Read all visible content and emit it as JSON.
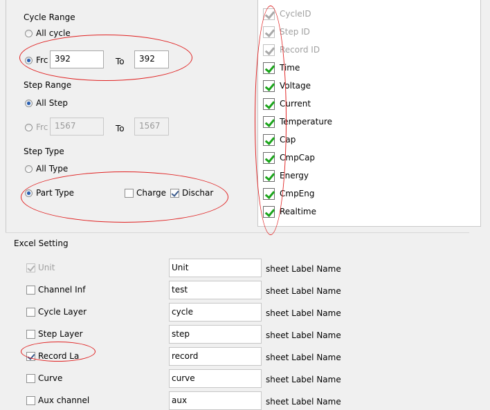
{
  "cycle_range": {
    "title": "Cycle Range",
    "all_label": "All cycle",
    "from_label": "Frc",
    "from_value": "392",
    "to_label": "To",
    "to_value": "392",
    "selected": "from"
  },
  "step_range": {
    "title": "Step Range",
    "all_label": "All Step",
    "from_label": "Frc",
    "from_value": "1567",
    "to_label": "To",
    "to_value": "1567",
    "selected": "all"
  },
  "step_type": {
    "title": "Step Type",
    "all_label": "All Type",
    "part_label": "Part Type",
    "charge_label": "Charge",
    "discharge_label": "Dischar",
    "selected": "part",
    "charge_checked": false,
    "discharge_checked": true
  },
  "columns": [
    {
      "label": "CycleID",
      "checked": true,
      "disabled": true
    },
    {
      "label": "Step ID",
      "checked": true,
      "disabled": true
    },
    {
      "label": "Record ID",
      "checked": true,
      "disabled": true
    },
    {
      "label": "Time",
      "checked": true,
      "disabled": false
    },
    {
      "label": "Voltage",
      "checked": true,
      "disabled": false
    },
    {
      "label": "Current",
      "checked": true,
      "disabled": false
    },
    {
      "label": "Temperature",
      "checked": true,
      "disabled": false
    },
    {
      "label": "Cap",
      "checked": true,
      "disabled": false
    },
    {
      "label": "CmpCap",
      "checked": true,
      "disabled": false
    },
    {
      "label": "Energy",
      "checked": true,
      "disabled": false
    },
    {
      "label": "CmpEng",
      "checked": true,
      "disabled": false
    },
    {
      "label": "Realtime",
      "checked": true,
      "disabled": false
    }
  ],
  "excel": {
    "title": "Excel Setting",
    "suffix": "sheet Label Name",
    "rows": [
      {
        "label": "Unit",
        "value": "Unit",
        "checked": true,
        "disabled": true
      },
      {
        "label": "Channel Inf",
        "value": "test",
        "checked": false,
        "disabled": false
      },
      {
        "label": "Cycle Layer",
        "value": "cycle",
        "checked": false,
        "disabled": false
      },
      {
        "label": "Step Layer",
        "value": "step",
        "checked": false,
        "disabled": false
      },
      {
        "label": "Record La",
        "value": "record",
        "checked": true,
        "disabled": false
      },
      {
        "label": "Curve",
        "value": "curve",
        "checked": false,
        "disabled": false
      },
      {
        "label": "Aux channel",
        "value": "aux",
        "checked": false,
        "disabled": false
      }
    ]
  },
  "colors": {
    "annotation_red": "#e02020",
    "check_green": "#1aa41a",
    "radio_blue": "#2a5fb0"
  }
}
